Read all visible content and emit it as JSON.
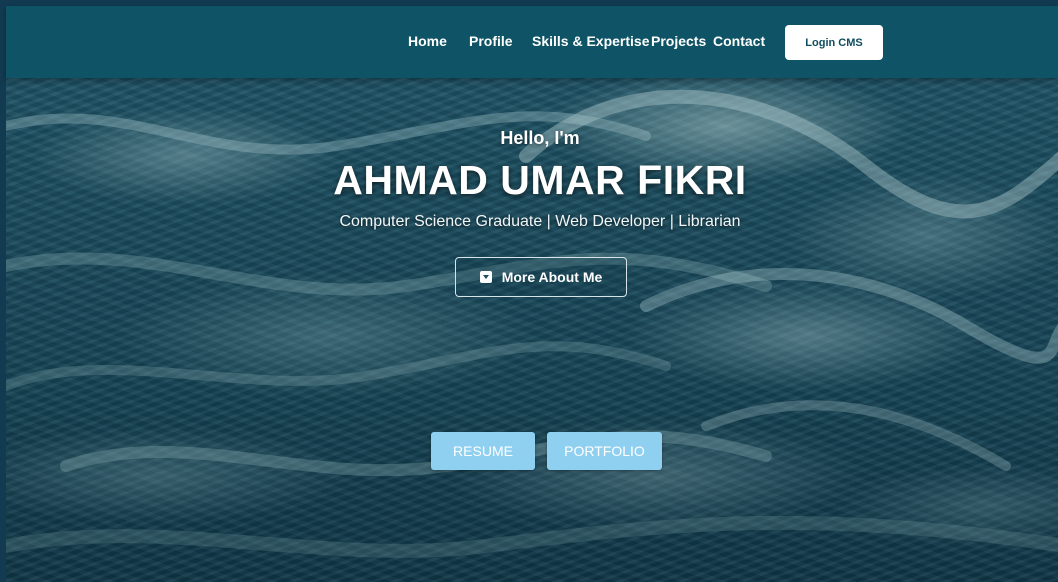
{
  "nav": {
    "links": [
      "Home",
      "Profile",
      "Skills & Expertise",
      "Projects",
      "Contact"
    ],
    "login_label": "Login CMS"
  },
  "hero": {
    "greeting": "Hello, I'm",
    "name": "AHMAD UMAR FIKRI",
    "subtitle": "Computer Science Graduate | Web Developer | Librarian",
    "more_label": "More About Me",
    "more_icon": "caret-square-down-icon",
    "buttons": [
      "RESUME",
      "PORTFOLIO"
    ]
  },
  "colors": {
    "navbar": "#0f5466",
    "cta": "#8fd0f1",
    "text": "#ffffff"
  }
}
